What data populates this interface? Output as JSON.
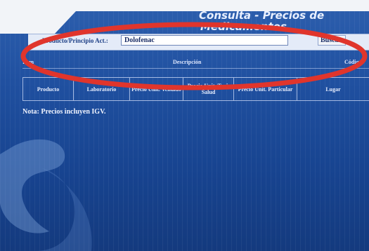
{
  "header": {
    "title_line1": "Consulta - Precios de",
    "title_line2": "Medicamentos."
  },
  "search": {
    "label": "Producto/Principio Act.:",
    "value": "Dolofenac",
    "button_label": "Buscar"
  },
  "results_header": {
    "col1": "Item",
    "col2": "Descripción",
    "col3": "Código"
  },
  "price_table": {
    "columns": [
      "Producto",
      "Laboratorio",
      "Precio Unit. Vendido",
      "Precio Unit. Tarj. Salud",
      "Precio Unit. Particular",
      "Lugar"
    ]
  },
  "note": "Nota: Precios incluyen IGV.",
  "colors": {
    "background": "#1f4f9f",
    "annotation_ellipse": "#e0352c",
    "panel": "#e4ebf8"
  }
}
